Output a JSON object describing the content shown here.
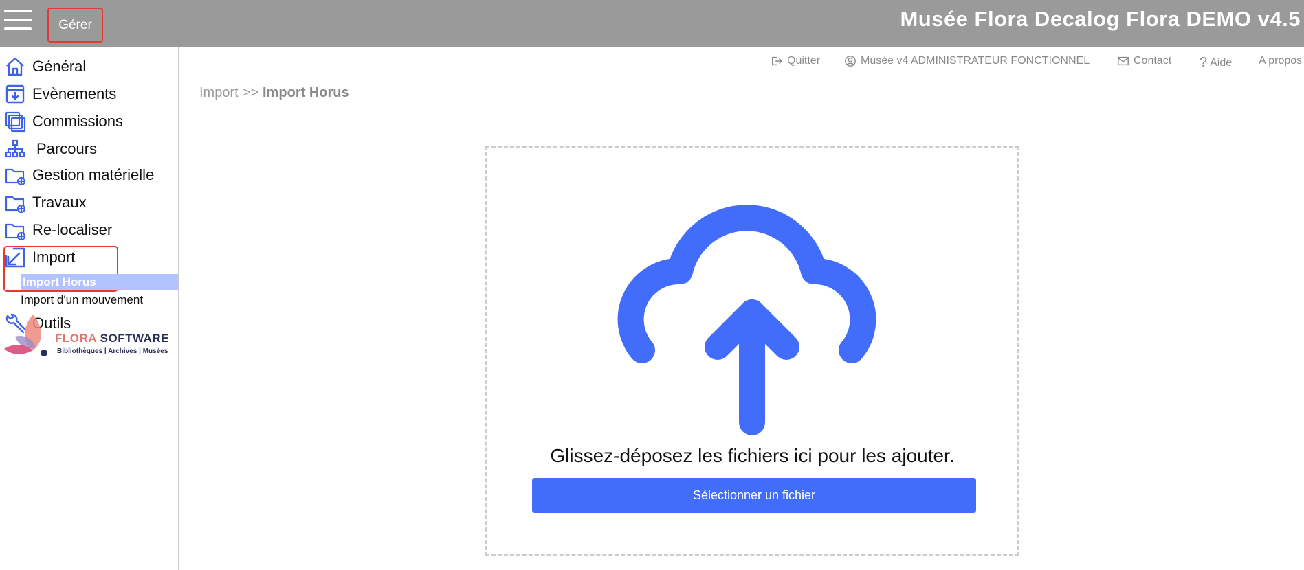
{
  "topbar": {
    "manage_label": "Gérer",
    "app_title": "Musée Flora Decalog Flora DEMO v4.5"
  },
  "header_links": {
    "quit": "Quitter",
    "user": "Musée v4 ADMINISTRATEUR FONCTIONNEL",
    "contact": "Contact",
    "help": "Aide",
    "about": "A propos"
  },
  "sidebar": {
    "items": [
      {
        "label": "Général",
        "icon": "home-icon"
      },
      {
        "label": "Evènements",
        "icon": "inbox-download-icon"
      },
      {
        "label": "Commissions",
        "icon": "stacked-folders-icon"
      },
      {
        "label": "Parcours",
        "icon": "sitemap-icon"
      },
      {
        "label": "Gestion matérielle",
        "icon": "folder-globe-icon"
      },
      {
        "label": "Travaux",
        "icon": "folder-globe-icon"
      },
      {
        "label": "Re-localiser",
        "icon": "folder-globe-icon"
      },
      {
        "label": "Import",
        "icon": "import-arrow-icon"
      },
      {
        "label": "Outils",
        "icon": "wrench-icon"
      }
    ],
    "import_sub": [
      {
        "label": "Import Horus",
        "active": true
      },
      {
        "label": "Import d'un mouvement",
        "active": false
      }
    ]
  },
  "logo": {
    "brand_first": "FLORA",
    "brand_second": "SOFTWARE",
    "tagline": "Bibliothèques | Archives | Musées"
  },
  "breadcrumb": {
    "parent": "Import",
    "separator": ">>",
    "current": "Import Horus"
  },
  "dropzone": {
    "instruction": "Glissez-déposez les fichiers ici pour les ajouter.",
    "button_label": "Sélectionner un fichier"
  },
  "colors": {
    "topbar_bg": "#9a9a9a",
    "accent_blue": "#426cfa",
    "icon_blue": "#3f63e8",
    "highlight_red": "#e53935",
    "active_sub_bg": "#b3c3ff"
  }
}
